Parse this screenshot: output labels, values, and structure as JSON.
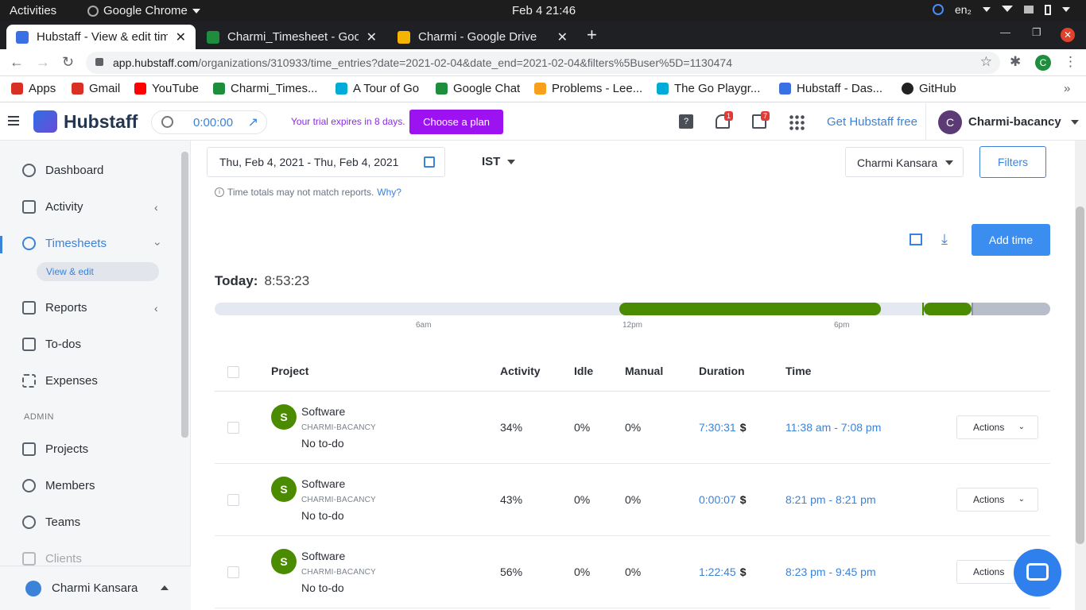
{
  "os": {
    "activities": "Activities",
    "app_name": "Google Chrome",
    "clock": "Feb 4  21:46",
    "lang": "en₂"
  },
  "tabs": [
    {
      "title": "Hubstaff - View & edit tim",
      "active": true,
      "fav_color": "#3b6fe4"
    },
    {
      "title": "Charmi_Timesheet - Goog",
      "active": false,
      "fav_color": "#1e8e3e"
    },
    {
      "title": "Charmi - Google Drive",
      "active": false,
      "fav_color": "#f4b400"
    }
  ],
  "address": {
    "host": "app.hubstaff.com",
    "path": "/organizations/310933/time_entries?date=2021-02-04&date_end=2021-02-04&filters%5Buser%5D=1130474",
    "profile": "C"
  },
  "bookmarks": [
    {
      "label": "Apps",
      "color": "#d93025"
    },
    {
      "label": "Gmail",
      "color": "#d93025"
    },
    {
      "label": "YouTube",
      "color": "#ff0000"
    },
    {
      "label": "Charmi_Times...",
      "color": "#1e8e3e"
    },
    {
      "label": "A Tour of Go",
      "color": "#00acd7"
    },
    {
      "label": "Google Chat",
      "color": "#1e8e3e"
    },
    {
      "label": "Problems - Lee...",
      "color": "#f89f1b"
    },
    {
      "label": "The Go Playgr...",
      "color": "#00acd7"
    },
    {
      "label": "Hubstaff - Das...",
      "color": "#3b6fe4"
    },
    {
      "label": "GitHub",
      "color": "#222222"
    }
  ],
  "header": {
    "logo": "Hubstaff",
    "timer": "0:00:00",
    "trial": "Your trial expires in 8 days.",
    "plan_button": "Choose a plan",
    "notif_count": "1",
    "gift_count": "7",
    "help": "?",
    "get_free": "Get Hubstaff free",
    "user_initial": "C",
    "user_name": "Charmi-bacancy"
  },
  "sidebar": {
    "dashboard": "Dashboard",
    "activity": "Activity",
    "timesheets": "Timesheets",
    "view_edit": "View & edit",
    "reports": "Reports",
    "todos": "To-dos",
    "expenses": "Expenses",
    "admin": "ADMIN",
    "projects": "Projects",
    "members": "Members",
    "teams": "Teams",
    "clients": "Clients",
    "footer_user": "Charmi Kansara"
  },
  "main": {
    "date_range": "Thu, Feb 4, 2021 - Thu, Feb 4, 2021",
    "timezone": "IST",
    "member": "Charmi Kansara",
    "filters": "Filters",
    "note": "Time totals may not match reports.",
    "note_link": "Why?",
    "add_time": "Add time",
    "today_label": "Today:",
    "today_total": "8:53:23",
    "ticks": [
      "6am",
      "12pm",
      "6pm"
    ],
    "columns": {
      "project": "Project",
      "activity": "Activity",
      "idle": "Idle",
      "manual": "Manual",
      "duration": "Duration",
      "time": "Time"
    },
    "rows": [
      {
        "initial": "S",
        "project": "Software",
        "org": "CHARMI-BACANCY",
        "todo": "No to-do",
        "activity": "34%",
        "idle": "0%",
        "manual": "0%",
        "duration": "7:30:31",
        "currency": "$",
        "time": "11:38 am - 7:08 pm",
        "actions": "Actions"
      },
      {
        "initial": "S",
        "project": "Software",
        "org": "CHARMI-BACANCY",
        "todo": "No to-do",
        "activity": "43%",
        "idle": "0%",
        "manual": "0%",
        "duration": "0:00:07",
        "currency": "$",
        "time": "8:21 pm - 8:21 pm",
        "actions": "Actions"
      },
      {
        "initial": "S",
        "project": "Software",
        "org": "CHARMI-BACANCY",
        "todo": "No to-do",
        "activity": "56%",
        "idle": "0%",
        "manual": "0%",
        "duration": "1:22:45",
        "currency": "$",
        "time": "8:23 pm - 9:45 pm",
        "actions": "Actions"
      }
    ]
  },
  "colors": {
    "accent": "#3b82d9",
    "plan": "#9c12f0",
    "project_green": "#4b8b00"
  }
}
